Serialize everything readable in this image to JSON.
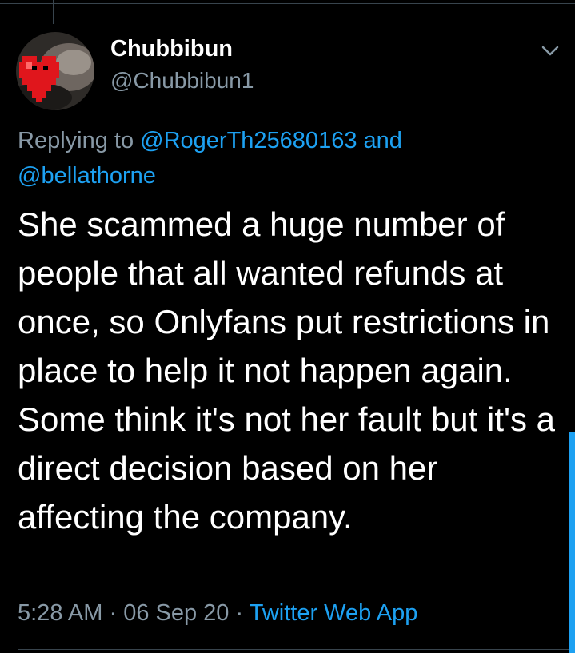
{
  "tweet": {
    "display_name": "Chubbibun",
    "handle": "@Chubbibun1",
    "replying_prefix": "Replying to",
    "reply_to_1": "@RogerTh25680163",
    "reply_and": "and",
    "reply_to_2": "@bellathorne",
    "text": "She scammed a huge number of people that all wanted refunds at once, so Onlyfans put restrictions in place to help it not happen again. Some think it's not her fault but it's a direct decision based on her affecting the company.",
    "time": "5:28 AM",
    "date": "06 Sep 20",
    "separator": "·",
    "source": "Twitter Web App"
  },
  "icons": {
    "avatar": "red-pixel-heart-avatar",
    "more": "chevron-down-icon"
  },
  "colors": {
    "background": "#000000",
    "primary_text": "#ffffff",
    "secondary_text": "#8899a6",
    "link": "#1da1f2",
    "divider": "#38444d"
  }
}
